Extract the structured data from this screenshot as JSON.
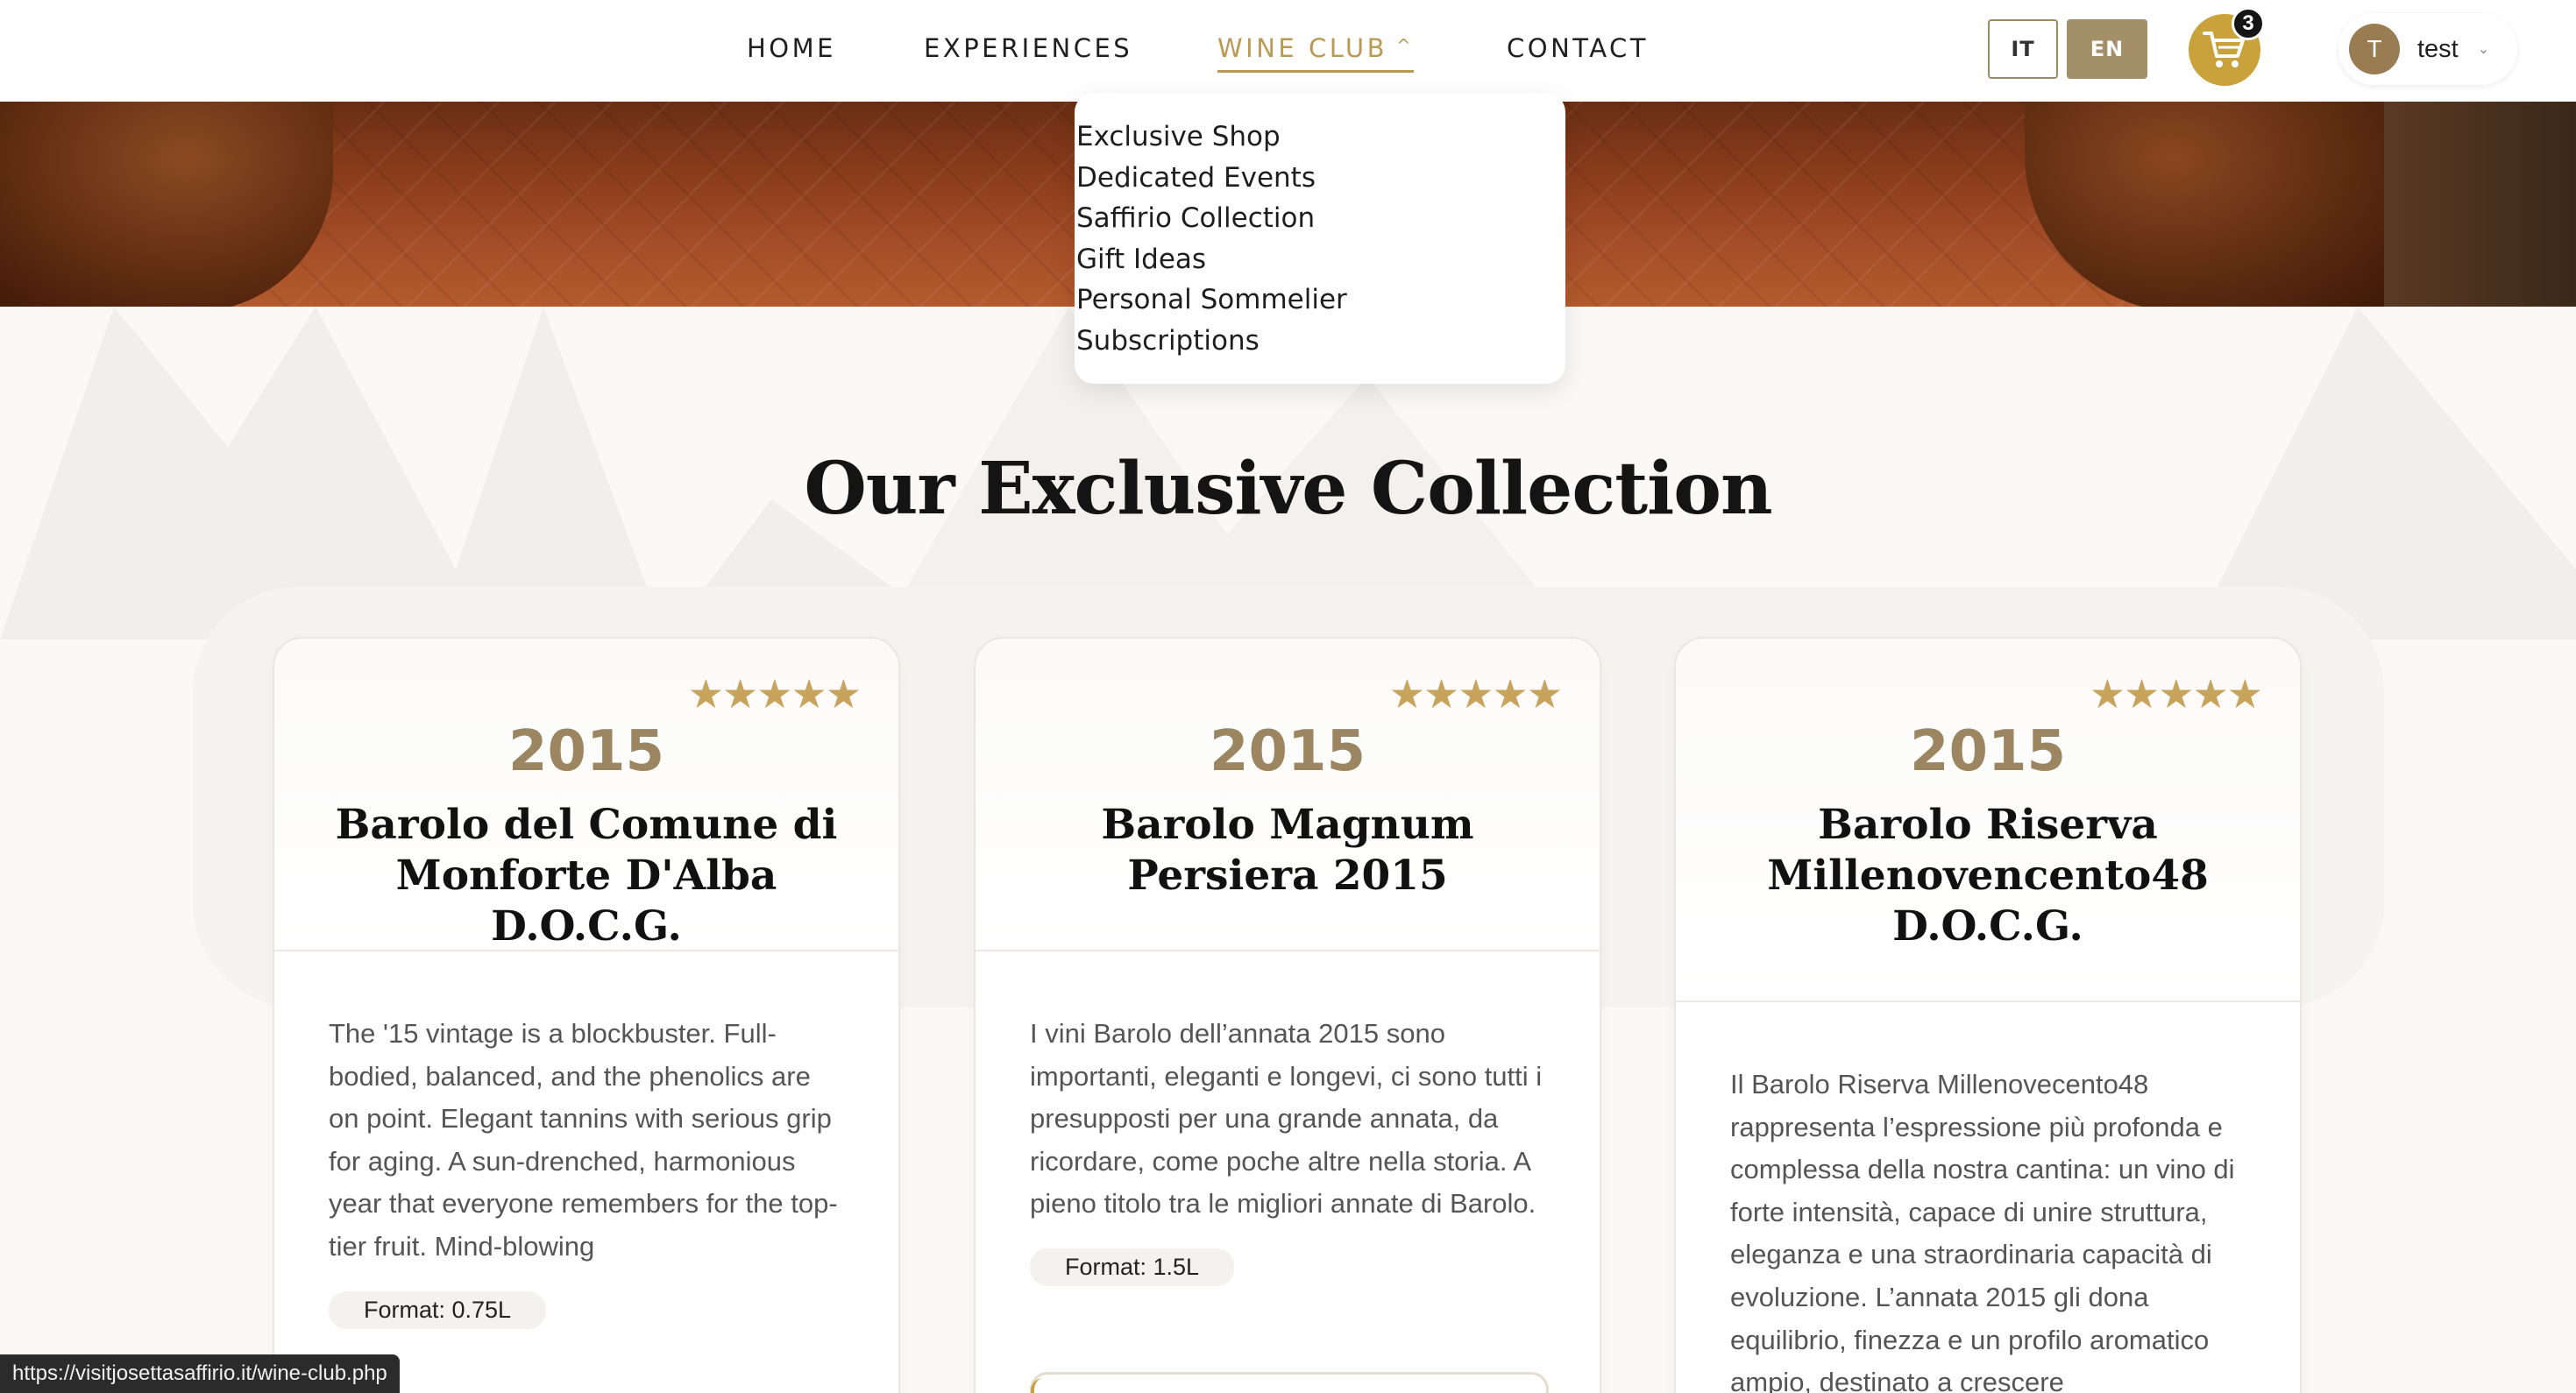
{
  "nav": {
    "home": "HOME",
    "experiences": "EXPERIENCES",
    "wine_club": "WINE CLUB",
    "contact": "CONTACT"
  },
  "lang": {
    "it": "IT",
    "en": "EN",
    "active": "EN"
  },
  "cart": {
    "count": "3"
  },
  "user": {
    "initial": "T",
    "name": "test"
  },
  "dropdown": {
    "items": [
      "Exclusive Shop",
      "Dedicated Events",
      "Saffirio Collection",
      "Gift Ideas",
      "Personal Sommelier",
      "Subscriptions"
    ]
  },
  "section": {
    "title": "Our Exclusive Collection"
  },
  "cards": [
    {
      "rating": 5,
      "year": "2015",
      "name": "Barolo del Comune di Monforte D'Alba D.O.C.G.",
      "description": "The '15 vintage is a blockbuster. Full-bodied, balanced, and the phenolics are on point. Elegant tannins with serious grip for aging. A sun-drenched, harmonious year that everyone remembers for the top-tier fruit. Mind-blowing",
      "format": "Format: 0.75L"
    },
    {
      "rating": 5,
      "year": "2015",
      "name": "Barolo Magnum Persiera 2015",
      "description": "I vini Barolo dell’annata 2015 sono importanti, eleganti e longevi, ci sono tutti i presupposti per una grande annata, da ricordare, come poche altre nella storia. A pieno titolo tra le migliori annate di Barolo.",
      "format": "Format: 1.5L"
    },
    {
      "rating": 5,
      "year": "2015",
      "name": "Barolo Riserva Millenovencento48 D.O.C.G.",
      "description": "Il Barolo Riserva Millenovecento48 rappresenta l’espressione più profonda e complessa della nostra cantina: un vino di forte intensità, capace di unire struttura, eleganza e una straordinaria capacità di evoluzione. L’annata 2015 gli dona equilibrio, finezza e un profilo aromatico ampio, destinato a crescere"
    }
  ],
  "stars": "★★★★★",
  "status_url": "https://visitjosettasaffirio.it/wine-club.php",
  "colors": {
    "accent": "#b99a55",
    "cart": "#c9a23b",
    "lang_active": "#a38f68"
  }
}
